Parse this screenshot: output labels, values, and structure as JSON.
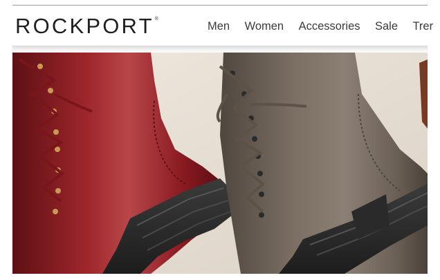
{
  "brand": {
    "name": "ROCKPORT",
    "mark": "®"
  },
  "nav": {
    "items": [
      "Men",
      "Women",
      "Accessories",
      "Sale",
      "Trer"
    ]
  },
  "hero": {
    "subject": "two lace-up leather boots",
    "colors": {
      "left_boot": "#8e1f24",
      "right_boot": "#6e6257",
      "background": "#e6ddd2",
      "sole": "#2c2c2c"
    }
  }
}
